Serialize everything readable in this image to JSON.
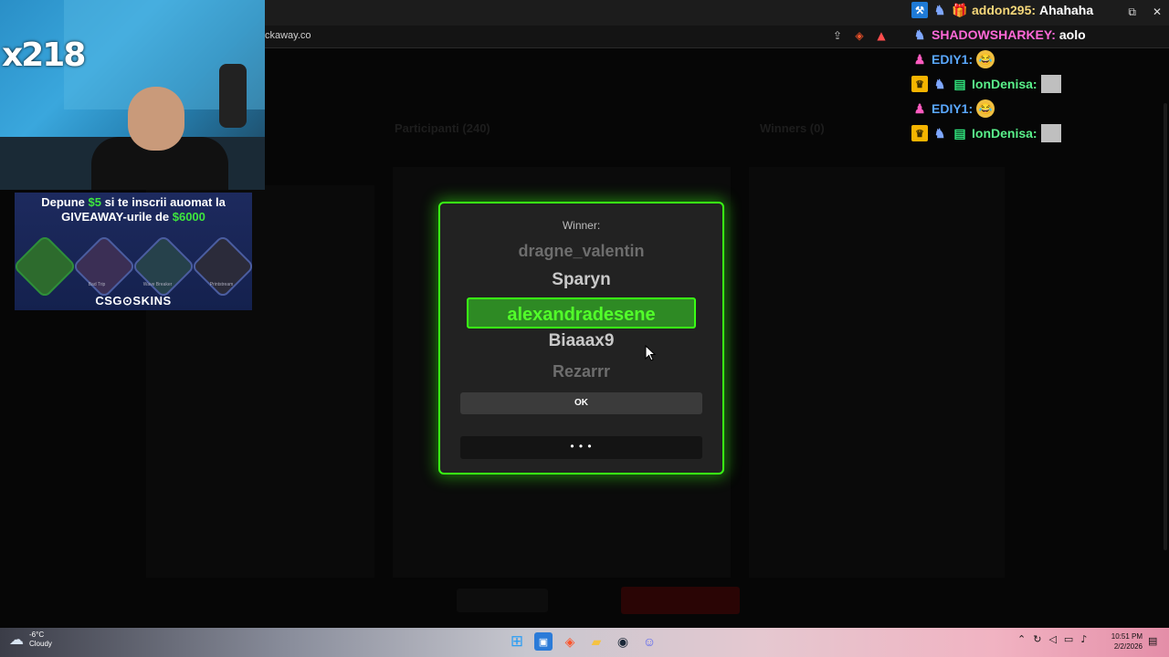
{
  "browser": {
    "url": "ckaway.co",
    "window_controls": {
      "restore": "⧉",
      "close": "✕"
    }
  },
  "background": {
    "faint_heading_left": "Participanti (240)",
    "faint_heading_right": "Winners (0)"
  },
  "webcam": {
    "multiplier": "x218"
  },
  "ad": {
    "line1_prefix": "Depune ",
    "line1_amount": "$5",
    "line1_suffix": " si te inscrii auomat la",
    "line2_prefix": "GIVEAWAY-urile de ",
    "line2_amount": "$6000",
    "captions": [
      "Bad Trip",
      "Wave Breaker",
      "Printstream"
    ],
    "logo": "CSG⊙SKINS"
  },
  "chat": {
    "messages": [
      {
        "user": "addon295:",
        "text": "Ahahaha",
        "color": "#f5d77a"
      },
      {
        "user": "SHADOWSHARKEY:",
        "text": "aolo",
        "color": "#ff69d8"
      },
      {
        "user": "EDIY1:",
        "text": "",
        "color": "#5aa8ff"
      },
      {
        "user": "IonDenisa:",
        "text": "",
        "color": "#59f08a"
      },
      {
        "user": "EDIY1:",
        "text": "",
        "color": "#5aa8ff"
      },
      {
        "user": "IonDenisa:",
        "text": "",
        "color": "#59f08a"
      }
    ]
  },
  "modal": {
    "label": "Winner:",
    "reel": [
      "dragne_valentin",
      "Sparyn",
      "alexandradesene",
      "Biaaax9",
      "Rezarrr"
    ],
    "winner": "alexandradesene",
    "ok_label": "OK",
    "loading": "• • •",
    "accent": "#39ff14"
  },
  "taskbar": {
    "weather_temp": "-6°C",
    "weather_desc": "Cloudy",
    "time": "10:51 PM",
    "date": "2/2/2026"
  }
}
